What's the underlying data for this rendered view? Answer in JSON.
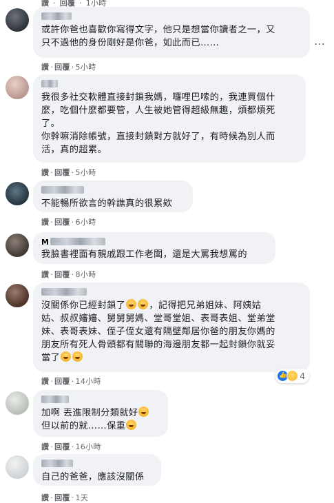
{
  "actions": {
    "reply": "回覆",
    "sep": "·",
    "read": "讚"
  },
  "top": {
    "partial_time": "1小時"
  },
  "comments": [
    {
      "text": "或許你爸也喜歡你寫得文字，他只是想當你讀者之一，又\n只不過他的身份剛好是你爸，如此而已……",
      "time": "5小時"
    },
    {
      "text": "我很多社交軟體直接封鎖我媽，囉哩巴嗦的，我連買個什\n麼，吃個什麼都要管，人生被她管得超級無趣，煩都煩死\n了。\n你幹嘛消除帳號，直接封鎖對方就好了，有時候為別人而\n活，真的超累。",
      "time": "5小時"
    },
    {
      "text": "不能暢所欲言的幹譙真的很累欸",
      "time": "6小時"
    },
    {
      "name_initial": "M",
      "text": "我臉書裡面有親戚跟工作老闆，還是大罵我想罵的",
      "time": "8小時"
    },
    {
      "text_a": "沒關係你已經封鎖了",
      "text_b": "，記得把兄弟姐妹、阿姨姑\n姑、叔叔嬸嬸、舅舅舅媽、堂哥堂姐、表哥表姐、堂弟堂\n妹、表哥表妹、侄子侄女還有隔壁鄰居你爸的朋友你媽的\n朋友所有死人骨頭都有關聯的海邊朋友都一起封鎖你就妥\n當了",
      "time": "14小時",
      "reaction_count": "4"
    },
    {
      "text_a": "加啊 丟進限制分類就好",
      "text_b": "\n但以前的就……保重",
      "time": "16小時"
    },
    {
      "text": "自己的爸爸，應該沒關係",
      "time": "1天"
    }
  ]
}
